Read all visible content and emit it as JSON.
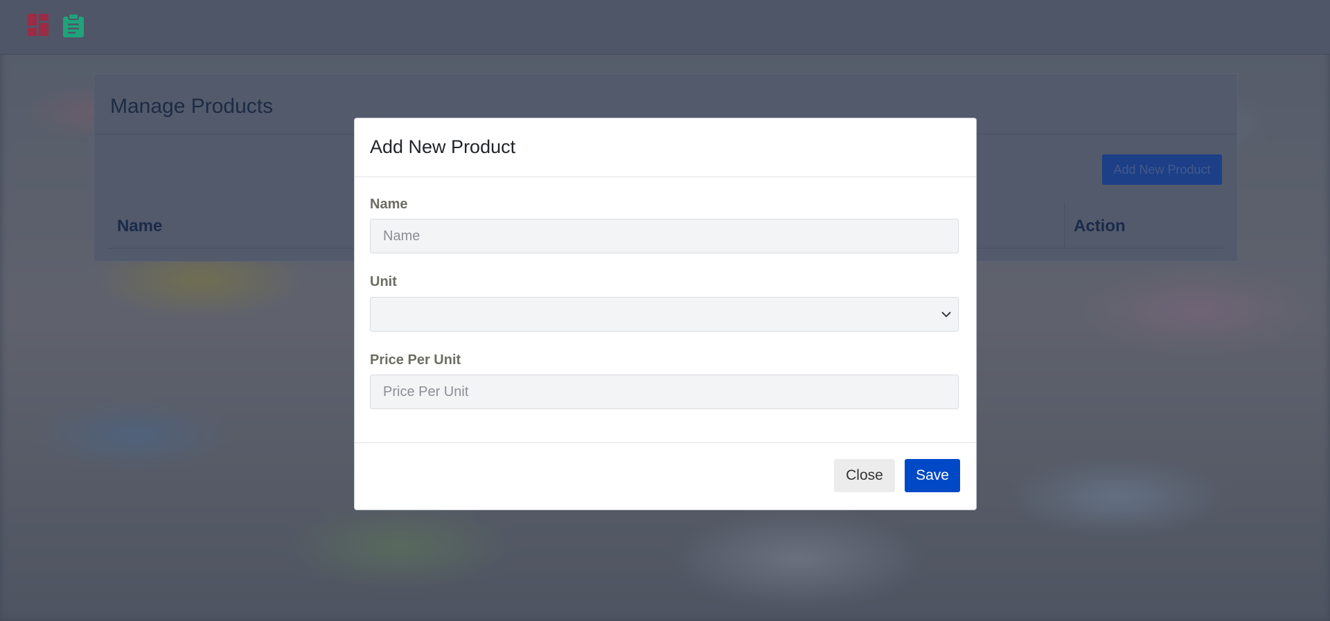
{
  "nav": {
    "icons": [
      "dashboard-icon",
      "clipboard-icon"
    ]
  },
  "page": {
    "title": "Manage Products",
    "add_button": "Add New Product",
    "table_headers": [
      "Name",
      "Action"
    ]
  },
  "modal": {
    "title": "Add New Product",
    "fields": {
      "name": {
        "label": "Name",
        "placeholder": "Name",
        "value": ""
      },
      "unit": {
        "label": "Unit",
        "value": ""
      },
      "price": {
        "label": "Price Per Unit",
        "placeholder": "Price Per Unit",
        "value": ""
      }
    },
    "close_label": "Close",
    "save_label": "Save"
  },
  "colors": {
    "primary": "#0049c6",
    "dashboard_icon": "#9b2c45",
    "clipboard_icon": "#1fa37a"
  }
}
